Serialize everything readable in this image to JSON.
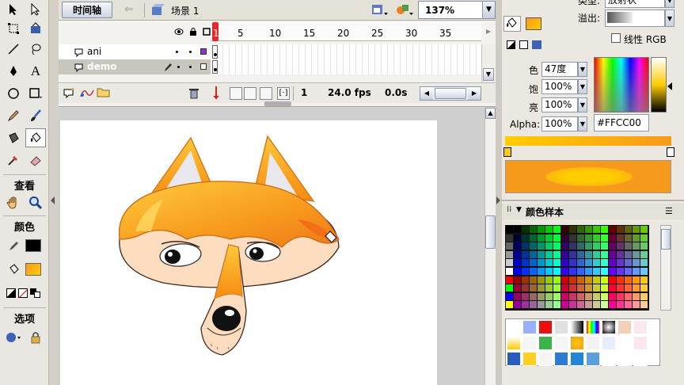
{
  "timeline": {
    "tab_label": "时间轴",
    "scene_label": "场景 1",
    "zoom": "137%",
    "frame_numbers": [
      "1",
      "5",
      "10",
      "15",
      "20",
      "25",
      "30",
      "35"
    ],
    "layers": [
      {
        "name": "ani"
      },
      {
        "name": "demo"
      }
    ],
    "current_frame": "1",
    "fps": "24.0 fps",
    "elapsed": "0.0s"
  },
  "toolbar": {
    "view_label": "查看",
    "colors_label": "颜色",
    "options_label": "选项"
  },
  "color_mixer": {
    "type_label": "类型:",
    "type_value": "放射状",
    "overflow_label": "溢出:",
    "linear_rgb_label": "线性 RGB",
    "hue_label": "色",
    "hue_value": "47度",
    "sat_label": "饱",
    "sat_value": "100%",
    "bright_label": "亮",
    "bright_value": "100%",
    "alpha_label": "Alpha:",
    "alpha_value": "100%",
    "hex_value": "#FFCC00",
    "colors": {
      "fill": "#f79a1c",
      "accent": "#ffcc00"
    }
  },
  "swatches_panel": {
    "title": "颜色样本"
  }
}
